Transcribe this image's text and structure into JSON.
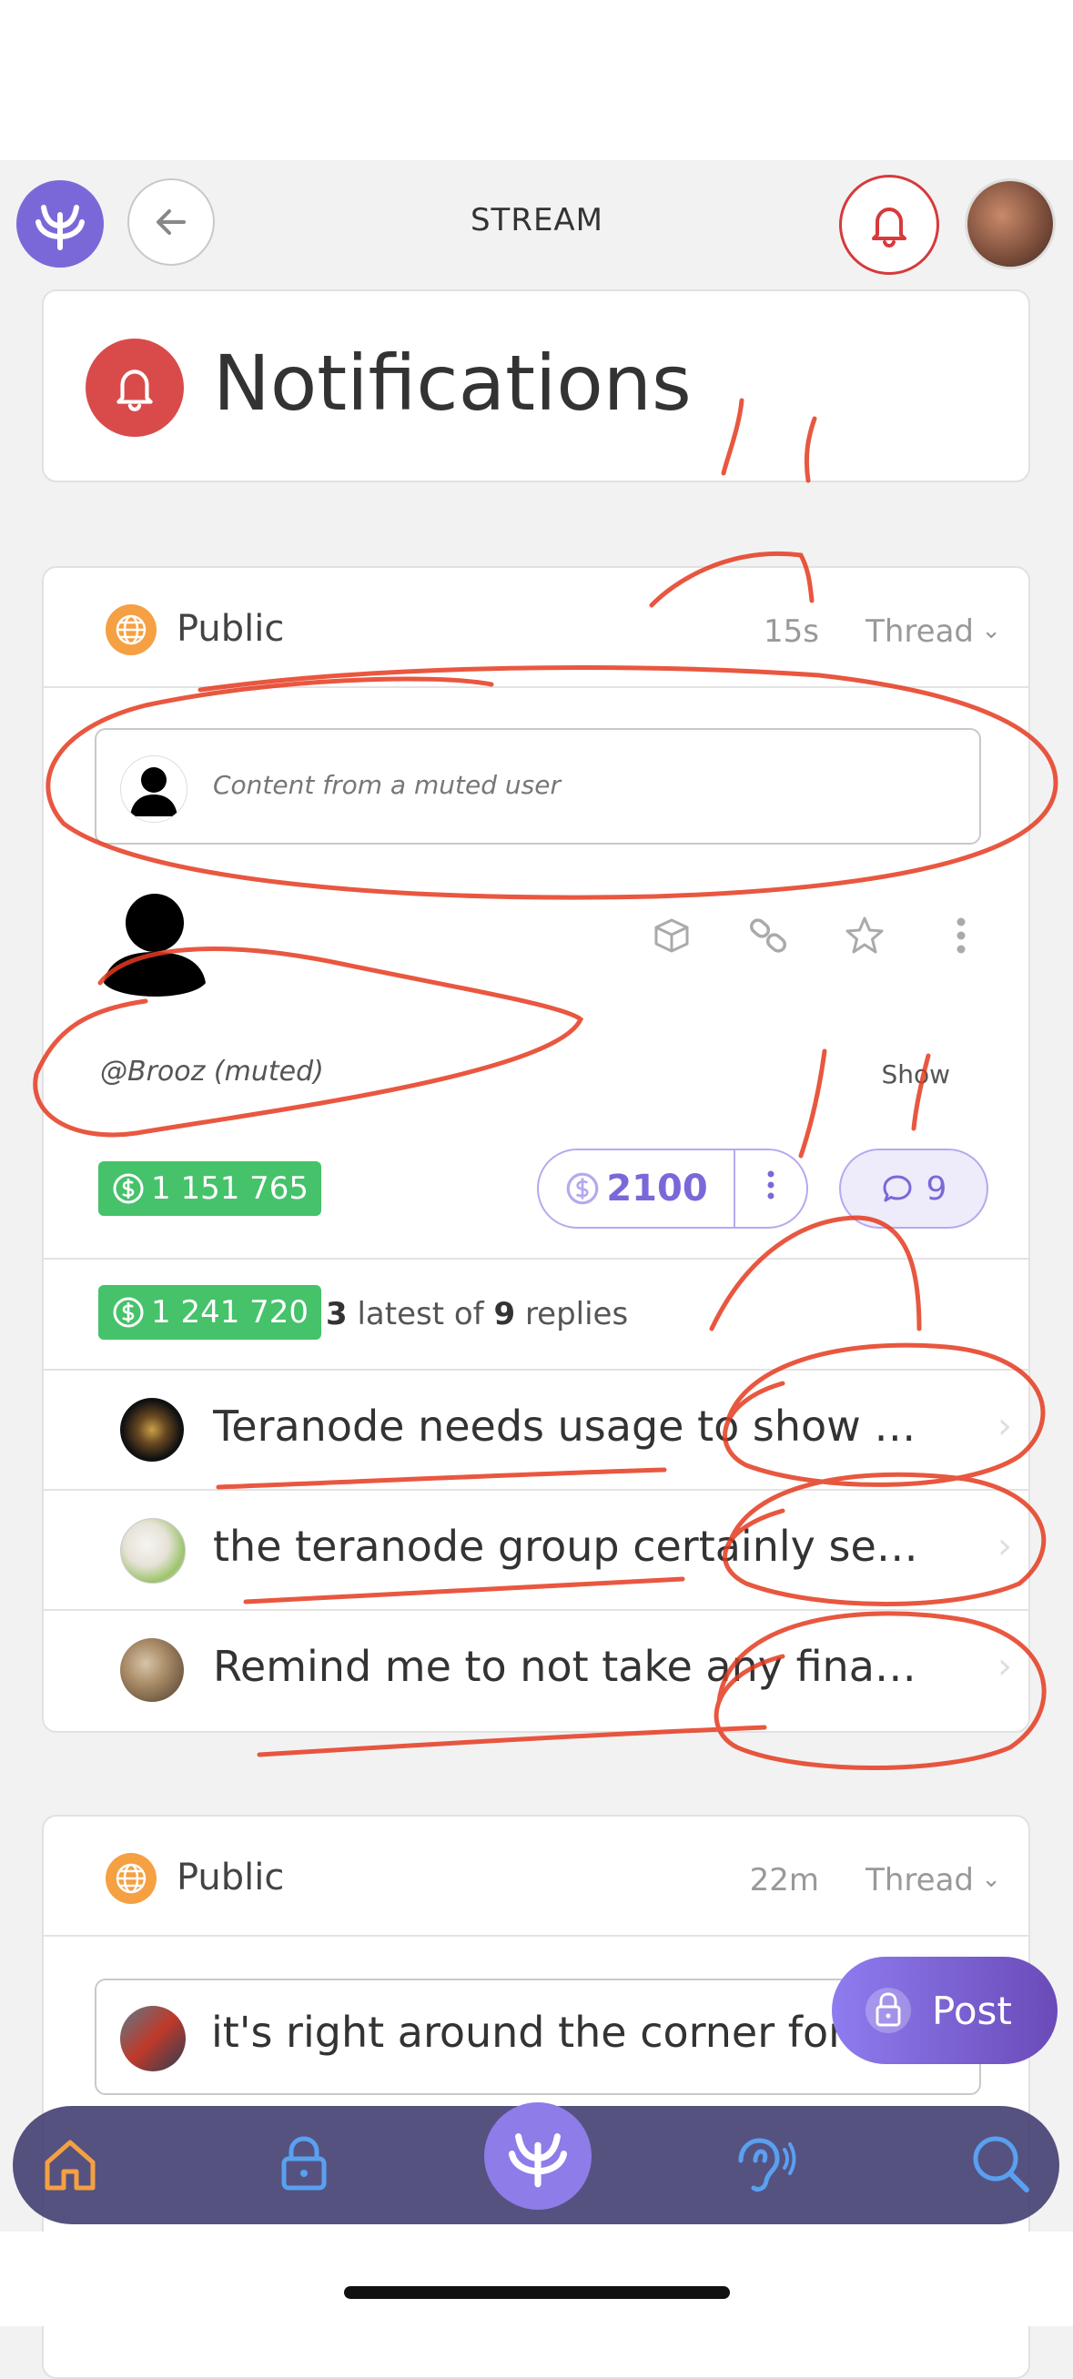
{
  "header": {
    "title": "STREAM"
  },
  "notifications_card": {
    "title": "Notifications"
  },
  "post1": {
    "visibility": "Public",
    "time": "15s",
    "thread_label": "Thread",
    "muted_notice": "Content from a muted user",
    "handle": "@Brooz (muted)",
    "show_label": "Show",
    "balance": "1 151 765",
    "pay_amount": "2100",
    "comment_count": "9",
    "replies_balance": "1 241 720",
    "replies_latest": "3",
    "replies_latest_label": "latest of",
    "replies_total": "9",
    "replies_label": "replies",
    "replies": [
      {
        "text": "Teranode needs usage to show off.…"
      },
      {
        "text": "the teranode group certainly seem…"
      },
      {
        "text": "Remind me to not take any financi…"
      }
    ]
  },
  "post2": {
    "visibility": "Public",
    "time": "22m",
    "thread_label": "Thread",
    "preview_text": "it's right around the corner for ye"
  },
  "fab": {
    "label": "Post"
  },
  "colors": {
    "accent": "#7b68d8",
    "alert": "#d63a3a",
    "money": "#45c26a",
    "public": "#f5a042"
  },
  "icons": [
    "relayx-logo-icon",
    "back-arrow-icon",
    "bell-icon",
    "globe-icon",
    "cube-icon",
    "link-icon",
    "star-icon",
    "more-vertical-icon",
    "coin-icon",
    "comment-icon",
    "lock-icon",
    "home-icon",
    "voice-icon",
    "search-icon",
    "chevron-down-icon",
    "chevron-right-icon"
  ]
}
